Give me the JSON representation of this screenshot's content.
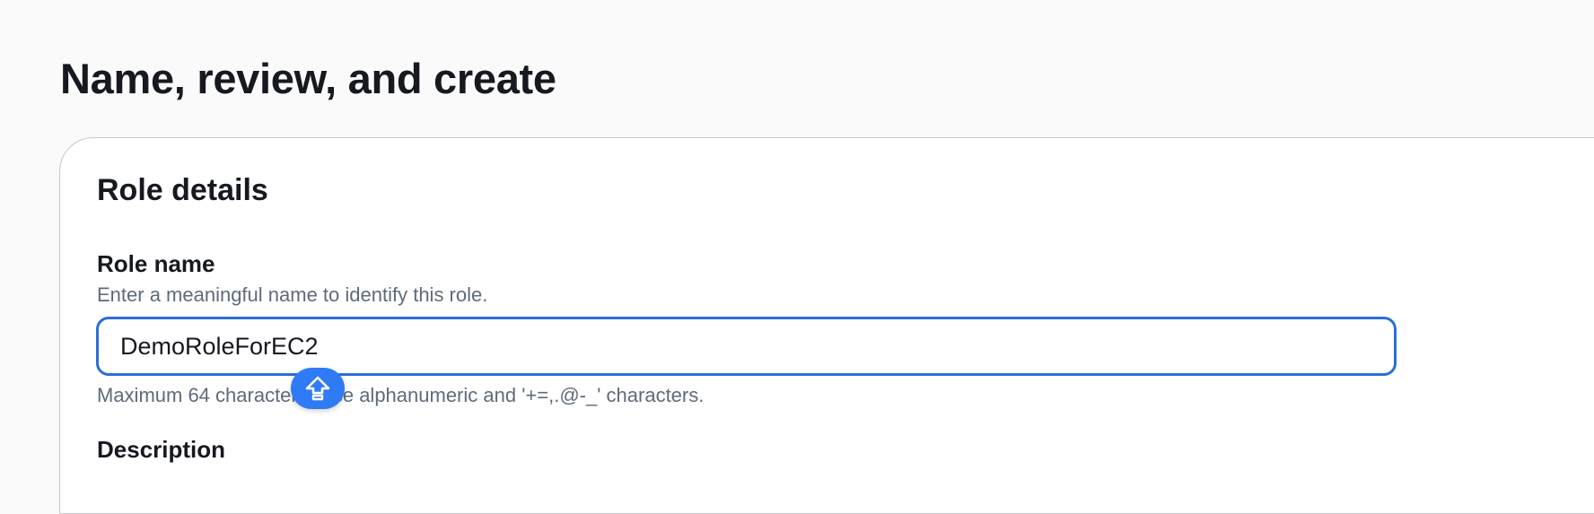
{
  "page": {
    "title": "Name, review, and create"
  },
  "role_details": {
    "title": "Role details",
    "role_name": {
      "label": "Role name",
      "description": "Enter a meaningful name to identify this role.",
      "value": "DemoRoleForEC2",
      "constraint": "Maximum 64 characters. Use alphanumeric and '+=,.@-_' characters."
    },
    "description": {
      "label": "Description"
    }
  },
  "overlay": {
    "icon": "shift-arrow-icon",
    "color": "#2f7bf6"
  },
  "colors": {
    "focus_border": "#2b6fd6",
    "secondary_text": "#5f6b7a"
  }
}
